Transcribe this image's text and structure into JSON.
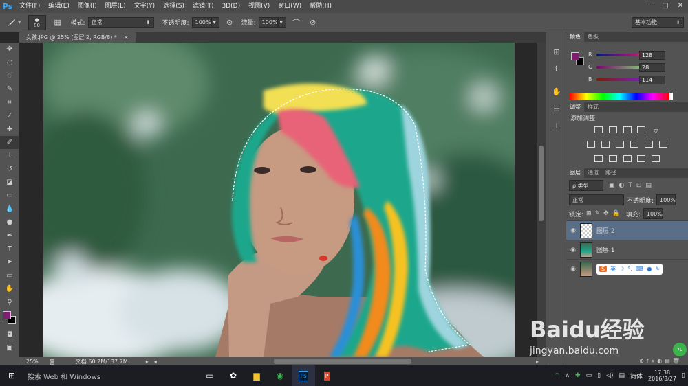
{
  "app": {
    "logo": "Ps"
  },
  "menu": [
    "文件(F)",
    "编辑(E)",
    "图像(I)",
    "图层(L)",
    "文字(Y)",
    "选择(S)",
    "滤镜(T)",
    "3D(D)",
    "视图(V)",
    "窗口(W)",
    "帮助(H)"
  ],
  "window_controls": [
    "─",
    "□",
    "✕"
  ],
  "options": {
    "brush_size": "80",
    "mode_label": "模式:",
    "mode_value": "正常",
    "opacity_label": "不透明度:",
    "opacity_value": "100%",
    "flow_label": "流量:",
    "flow_value": "100%",
    "workspace": "基本功能"
  },
  "doc_tab": {
    "title": "女孩.JPG @ 25% (图层 2, RGB/8) *",
    "close": "×"
  },
  "status": {
    "zoom": "25%",
    "doc": "文档:60.2M/137.7M"
  },
  "color_panel": {
    "tabs": [
      "颜色",
      "色板"
    ],
    "rows": [
      {
        "label": "R",
        "value": "128"
      },
      {
        "label": "G",
        "value": "28"
      },
      {
        "label": "B",
        "value": "114"
      }
    ],
    "foreground": "#801c72",
    "background": "#000000"
  },
  "adjust_panel": {
    "tabs": [
      "调整",
      "样式"
    ],
    "title": "添加调整"
  },
  "layers_panel": {
    "tabs": [
      "图层",
      "通道",
      "路径"
    ],
    "filter": "ρ 类型",
    "blend": "正常",
    "opacity_label": "不透明度:",
    "opacity_value": "100%",
    "lock_label": "锁定:",
    "fill_label": "填充:",
    "fill_value": "100%",
    "layers": [
      {
        "name": "图层 2",
        "selected": true
      },
      {
        "name": "图层 1",
        "selected": false
      }
    ]
  },
  "ime": {
    "label": "英"
  },
  "taskbar": {
    "search": "搜索 Web 和 Windows",
    "lang": "简体",
    "time": "17:38",
    "date": "2016/3/27"
  },
  "watermark": {
    "text": "Baidu经验",
    "url": "jingyan.baidu.com",
    "badge": "70"
  }
}
